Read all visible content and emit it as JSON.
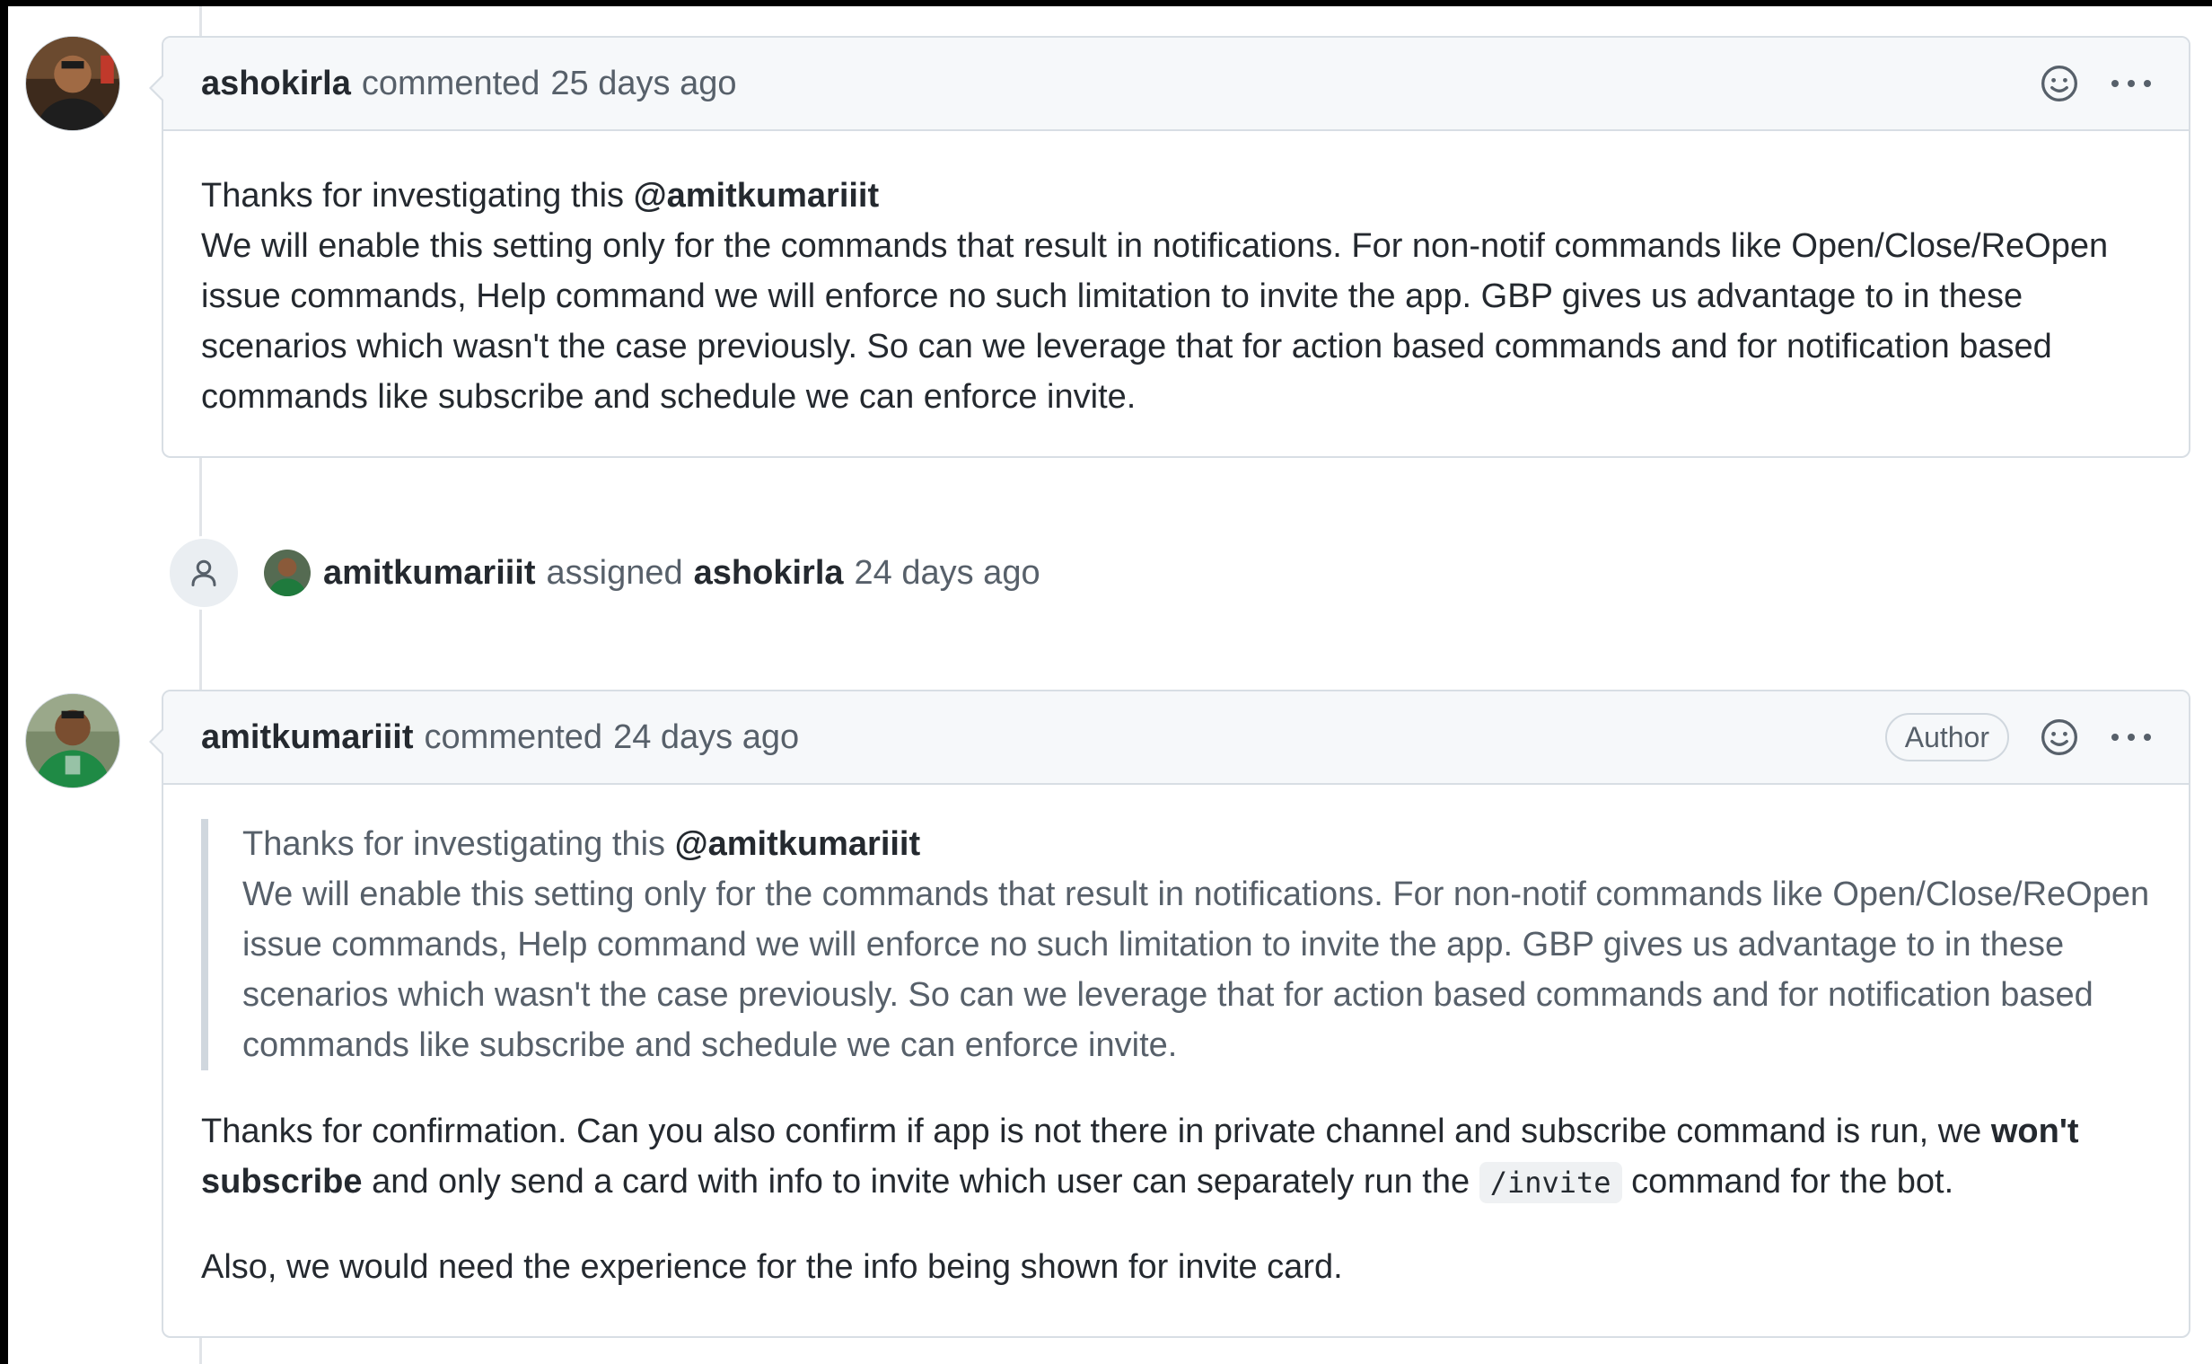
{
  "comment1": {
    "author": "ashokirla",
    "action": "commented",
    "time": "25 days ago",
    "body": {
      "line1_text": "Thanks for investigating this ",
      "line1_mention": "@amitkumariiit",
      "paragraph": "We will enable this setting only for the commands that result in notifications. For non-notif commands like Open/Close/ReOpen issue commands, Help command we will enforce no such limitation to invite the app. GBP gives us advantage to in these scenarios which wasn't the case previously. So can we leverage that for action based commands and for notification based commands like subscribe and schedule we can enforce invite."
    }
  },
  "event": {
    "actor": "amitkumariiit",
    "action": "assigned",
    "target": "ashokirla",
    "time": "24 days ago"
  },
  "comment2": {
    "author": "amitkumariiit",
    "action": "commented",
    "time": "24 days ago",
    "badge": "Author",
    "quote": {
      "line1_text": "Thanks for investigating this ",
      "line1_mention": "@amitkumariiit",
      "paragraph": "We will enable this setting only for the commands that result in notifications. For non-notif commands like Open/Close/ReOpen issue commands, Help command we will enforce no such limitation to invite the app. GBP gives us advantage to in these scenarios which wasn't the case previously. So can we leverage that for action based commands and for notification based commands like subscribe and schedule we can enforce invite."
    },
    "reply": {
      "part1": "Thanks for confirmation. Can you also confirm if app is not there in private channel and subscribe command is run, we ",
      "bold": "won't subscribe",
      "part2": " and only send a card with info to invite which user can separately run the ",
      "code": "/invite",
      "part3": " command for the bot."
    },
    "final": "Also, we would need the experience for the info being shown for invite card."
  },
  "icons": {
    "reaction": "smiley-icon",
    "menu": "kebab-horizontal-icon",
    "event": "person-icon"
  }
}
